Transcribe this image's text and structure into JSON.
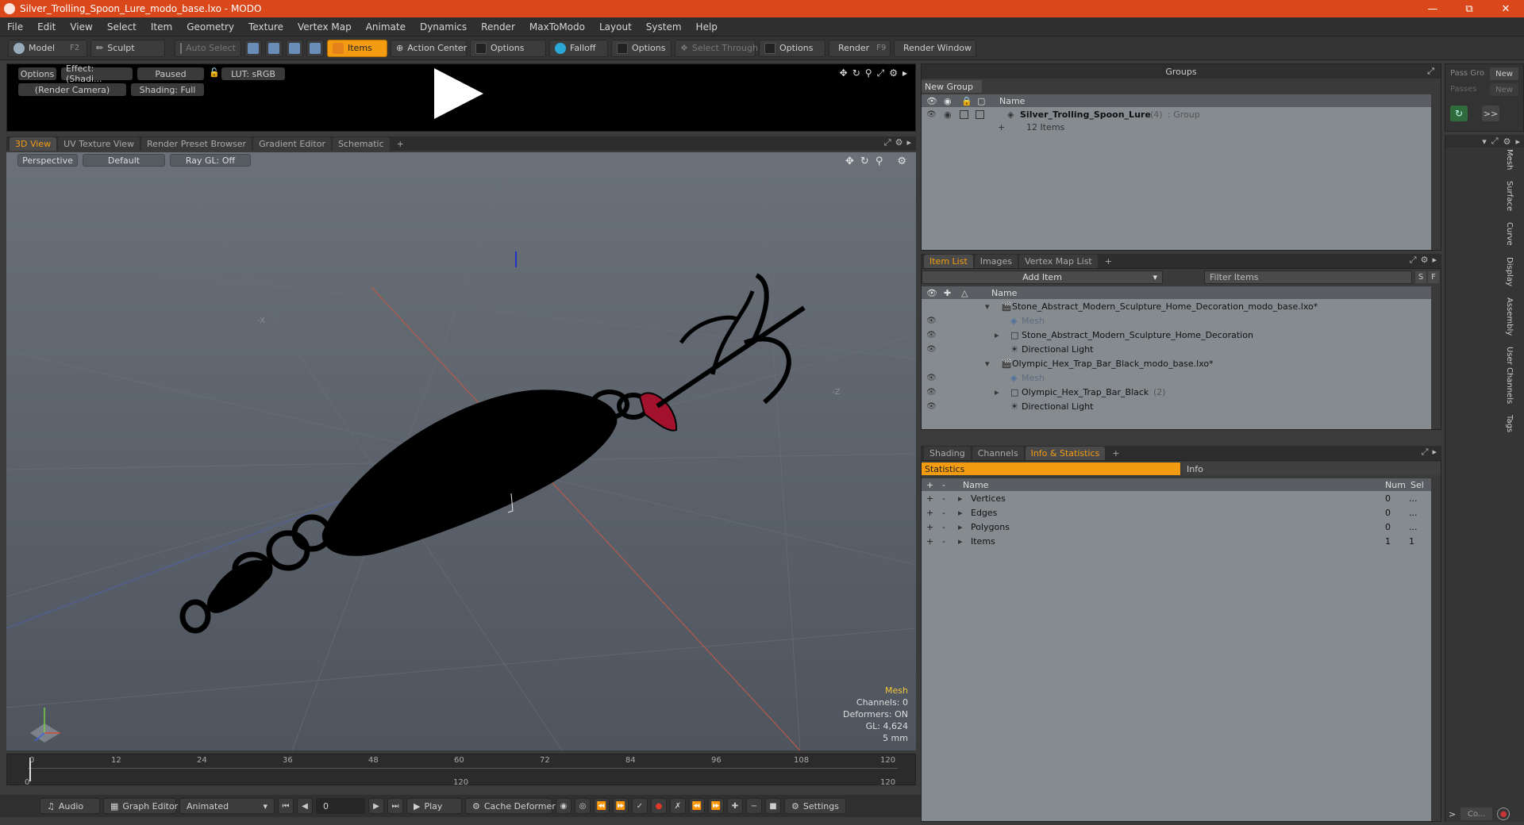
{
  "window": {
    "title": "Silver_Trolling_Spoon_Lure_modo_base.lxo - MODO"
  },
  "menu": [
    "File",
    "Edit",
    "View",
    "Select",
    "Item",
    "Geometry",
    "Texture",
    "Vertex Map",
    "Animate",
    "Dynamics",
    "Render",
    "MaxToModo",
    "Layout",
    "System",
    "Help"
  ],
  "toolbar": {
    "model": "Model",
    "model_key": "F2",
    "sculpt": "Sculpt",
    "auto_select": "Auto Select",
    "items": "Items",
    "action_center": "Action Center",
    "options1": "Options",
    "falloff": "Falloff",
    "options2": "Options",
    "select_through": "Select Through",
    "options3": "Options",
    "render": "Render",
    "render_key": "F9",
    "render_window": "Render Window"
  },
  "preview": {
    "options": "Options",
    "effect": "Effect: (Shadi...",
    "paused": "Paused",
    "lut": "LUT: sRGB",
    "camera": "(Render Camera)",
    "shading": "Shading: Full"
  },
  "viewport_tabs": [
    "3D View",
    "UV Texture View",
    "Render Preset Browser",
    "Gradient Editor",
    "Schematic",
    "+"
  ],
  "viewport": {
    "perspective": "Perspective",
    "default": "Default",
    "raygl": "Ray GL: Off",
    "axis_x": "-X",
    "axis_z": "-Z"
  },
  "hud": {
    "mesh": "Mesh",
    "channels": "Channels: 0",
    "deformers": "Deformers: ON",
    "gl": "GL: 4,624",
    "scale": "5 mm"
  },
  "timeline": {
    "ticks": [
      "0",
      "12",
      "24",
      "36",
      "48",
      "60",
      "72",
      "84",
      "96",
      "108",
      "120"
    ],
    "start": "0",
    "mid": "120",
    "end": "120"
  },
  "bottombar": {
    "audio": "Audio",
    "graph_editor": "Graph Editor",
    "animated": "Animated",
    "frame": "0",
    "play": "Play",
    "cache": "Cache Deformers",
    "settings": "Settings"
  },
  "groups": {
    "title": "Groups",
    "new_group": "New Group",
    "name_col": "Name",
    "group_name": "Silver_Trolling_Spoon_Lure",
    "group_count": "(4)",
    "group_type": ": Group",
    "items_count": "12 Items"
  },
  "pass": {
    "pass_groups": "Pass Gro",
    "new1": "New",
    "passes": "Passes",
    "new2": "New"
  },
  "itemlist_tabs": [
    "Item List",
    "Images",
    "Vertex Map List",
    "+"
  ],
  "itemlist": {
    "add_item": "Add Item",
    "filter": "Filter Items",
    "s": "S",
    "f": "F",
    "name_col": "Name",
    "rows": [
      {
        "label": "Stone_Abstract_Modern_Sculpture_Home_Decoration_modo_base.lxo*",
        "indent": 0,
        "kind": "scene"
      },
      {
        "label": "Mesh",
        "indent": 1,
        "kind": "mesh"
      },
      {
        "label": "Stone_Abstract_Modern_Sculpture_Home_Decoration",
        "indent": 1,
        "kind": "locator"
      },
      {
        "label": "Directional Light",
        "indent": 1,
        "kind": "light"
      },
      {
        "label": "Olympic_Hex_Trap_Bar_Black_modo_base.lxo*",
        "indent": 0,
        "kind": "scene"
      },
      {
        "label": "Mesh",
        "indent": 1,
        "kind": "mesh"
      },
      {
        "label": "Olympic_Hex_Trap_Bar_Black",
        "indent": 1,
        "kind": "locator",
        "suffix": "(2)"
      },
      {
        "label": "Directional Light",
        "indent": 1,
        "kind": "light"
      }
    ]
  },
  "info_tabs": [
    "Shading",
    "Channels",
    "Info & Statistics",
    "+"
  ],
  "stats": {
    "statistics": "Statistics",
    "info": "Info",
    "name_col": "Name",
    "num_col": "Num",
    "sel_col": "Sel",
    "rows": [
      {
        "name": "Vertices",
        "num": "0",
        "sel": "..."
      },
      {
        "name": "Edges",
        "num": "0",
        "sel": "..."
      },
      {
        "name": "Polygons",
        "num": "0",
        "sel": "..."
      },
      {
        "name": "Items",
        "num": "1",
        "sel": "1"
      }
    ]
  },
  "vtabs": [
    "Mesh",
    "Surface",
    "Curve",
    "Display",
    "Assembly",
    "User Channels",
    "Tags"
  ],
  "corner": {
    "co": "Co..."
  }
}
